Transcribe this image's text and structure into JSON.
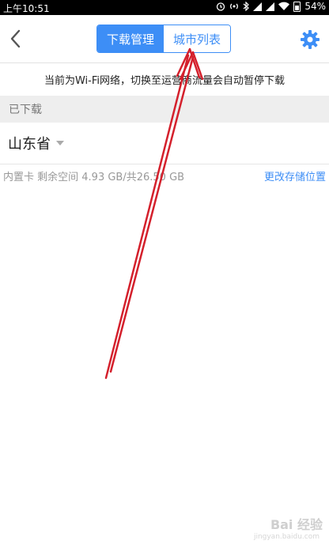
{
  "status_bar": {
    "time": "上午10:51",
    "battery": "54%",
    "icons": [
      "alarm-icon",
      "hotspot-icon",
      "bluetooth-icon",
      "signal-icon",
      "signal-icon",
      "wifi-icon",
      "battery-icon"
    ]
  },
  "header": {
    "tabs": [
      {
        "label": "下载管理",
        "active": true
      },
      {
        "label": "城市列表",
        "active": false
      }
    ],
    "accent_color": "#3d8ef6"
  },
  "notice": "当前为Wi-Fi网络，切换至运营商流量会自动暂停下载",
  "downloaded_section": {
    "title": "已下载",
    "items": [
      {
        "name": "山东省"
      }
    ]
  },
  "storage": {
    "info": "内置卡 剩余空间 4.93 GB/共26.50 GB",
    "change_location": "更改存储位置"
  },
  "watermark": {
    "text": "Bai 经验",
    "sub": "jingyan.baidu.com"
  }
}
